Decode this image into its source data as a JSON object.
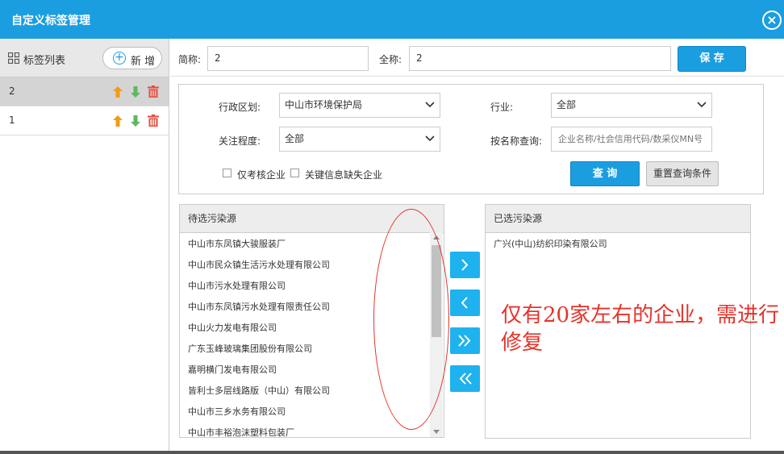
{
  "window": {
    "title": "自定义标签管理",
    "close_icon": "close-icon"
  },
  "sidebar": {
    "title": "标签列表",
    "add_label": "新 增",
    "items": [
      {
        "name": "2",
        "active": true
      },
      {
        "name": "1",
        "active": false
      }
    ]
  },
  "form": {
    "short_name_label": "简称:",
    "short_name_value": "2",
    "full_name_label": "全称:",
    "full_name_value": "2",
    "save_label": "保 存"
  },
  "query": {
    "region_label": "行政区划:",
    "region_value": "中山市环境保护局",
    "industry_label": "行业:",
    "industry_value": "全部",
    "attention_label": "关注程度:",
    "attention_value": "全部",
    "name_search_label": "按名称查询:",
    "name_search_placeholder": "企业名称/社会信用代码/数采仪MN号",
    "only_assess_label": "仅考核企业",
    "missing_info_label": "关键信息缺失企业",
    "query_label": "查 询",
    "reset_label": "重置查询条件"
  },
  "candidates": {
    "header": "待选污染源",
    "items": [
      "中山市东凤镇大骏服装厂",
      "中山市民众镇生活污水处理有限公司",
      "中山市污水处理有限公司",
      "中山市东凤镇污水处理有限责任公司",
      "中山火力发电有限公司",
      "广东玉峰玻璃集团股份有限公司",
      "嘉明横门发电有限公司",
      "皆利士多层线路版（中山）有限公司",
      "中山市三乡水务有限公司",
      "中山市丰裕泡沫塑料包装厂"
    ]
  },
  "selected": {
    "header": "已选污染源",
    "items": [
      "广兴(中山)纺织印染有限公司"
    ]
  },
  "annotation": {
    "text": "仅有20家左右的企业，需进行修复",
    "color": "#e5332a"
  },
  "colors": {
    "accent": "#1b9ee0",
    "move_button": "#1eb2ef",
    "up_arrow": "#f39c12",
    "down_arrow": "#5cb85c",
    "delete": "#e74c3c"
  }
}
